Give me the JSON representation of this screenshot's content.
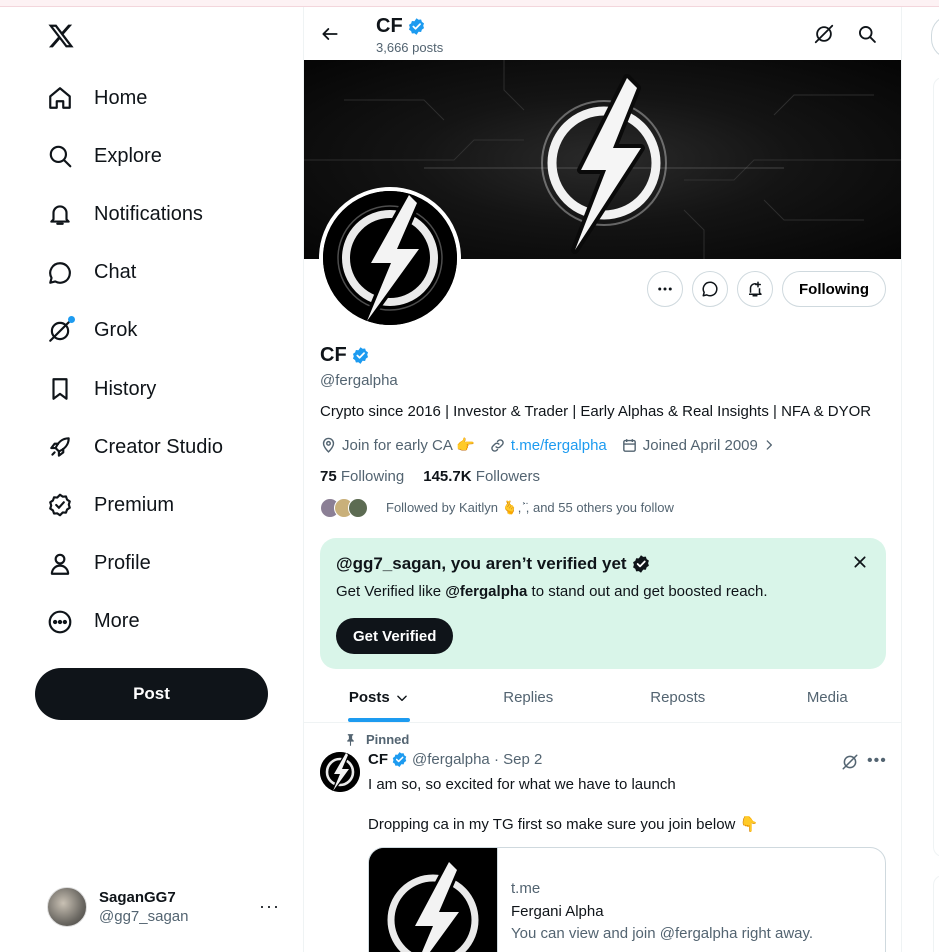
{
  "nav": {
    "items": [
      {
        "label": "Home",
        "icon": "home-icon"
      },
      {
        "label": "Explore",
        "icon": "search-icon"
      },
      {
        "label": "Notifications",
        "icon": "bell-icon"
      },
      {
        "label": "Chat",
        "icon": "chat-icon"
      },
      {
        "label": "Grok",
        "icon": "grok-icon"
      },
      {
        "label": "History",
        "icon": "bookmark-icon"
      },
      {
        "label": "Creator Studio",
        "icon": "rocket-icon"
      },
      {
        "label": "Premium",
        "icon": "verified-badge-icon"
      },
      {
        "label": "Profile",
        "icon": "person-icon"
      },
      {
        "label": "More",
        "icon": "more-circle-icon"
      }
    ],
    "post_label": "Post"
  },
  "account": {
    "name": "SaganGG7",
    "handle": "@gg7_sagan",
    "more": "···"
  },
  "header": {
    "name": "CF",
    "post_count": "3,666 posts"
  },
  "profile": {
    "name": "CF",
    "handle": "@fergalpha",
    "bio": "Crypto since 2016 | Investor & Trader | Early Alphas & Real Insights | NFA & DYOR",
    "location": "Join for early CA 👉",
    "link": "t.me/fergalpha",
    "joined": "Joined April 2009",
    "following_count": "75",
    "following_label": "Following",
    "followers_count": "145.7K",
    "followers_label": "Followers",
    "followed_by": "Followed by Kaitlyn 🫰,ʾ̈, and 55 others you follow",
    "follow_button": "Following"
  },
  "verify_card": {
    "title": "@gg7_sagan, you aren’t verified yet",
    "text_prefix": "Get Verified like ",
    "text_handle": "@fergalpha",
    "text_suffix": " to stand out and get boosted reach.",
    "button": "Get Verified"
  },
  "tabs": [
    {
      "label": "Posts",
      "active": true
    },
    {
      "label": "Replies",
      "active": false
    },
    {
      "label": "Reposts",
      "active": false
    },
    {
      "label": "Media",
      "active": false
    }
  ],
  "tweet": {
    "pinned_label": "Pinned",
    "name": "CF",
    "handle_date": "@fergalpha · Sep 2",
    "line1": "I am so, so excited for what we have to launch",
    "line2": "Dropping ca in my TG first so make sure you join below 👇",
    "card_domain": "t.me",
    "card_title": "Fergani Alpha",
    "card_desc": "You can view and join @fergalpha right away."
  },
  "colors": {
    "accent": "#1d9bf0",
    "text": "#0f1419",
    "muted": "#536471",
    "verify_bg": "#d9f5e9"
  }
}
